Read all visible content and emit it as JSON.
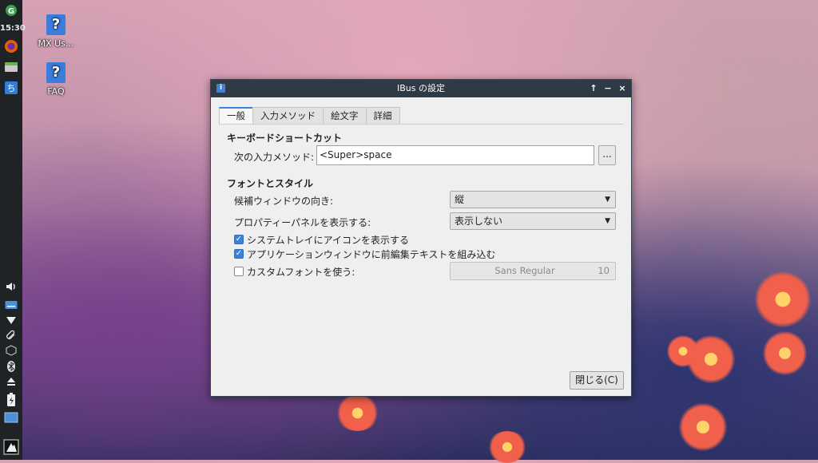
{
  "taskbar": {
    "clock": "15:30",
    "icons": [
      "update-icon",
      "firefox-icon",
      "file-manager-icon",
      "input-method-icon",
      "volume-icon",
      "keyboard-icon",
      "network-icon",
      "clip-icon",
      "package-icon",
      "bluetooth-icon",
      "eject-icon",
      "battery-icon",
      "window-icon",
      "mx-menu-icon"
    ]
  },
  "desktop": {
    "icons": [
      {
        "label": "MX Us..."
      },
      {
        "label": "FAQ"
      }
    ]
  },
  "dialog": {
    "title": "IBus の設定",
    "tabs": [
      "一般",
      "入力メソッド",
      "絵文字",
      "詳細"
    ],
    "keyboard_section": "キーボードショートカット",
    "next_method_label": "次の入力メソッド:",
    "next_method_value": "<Super>space",
    "more_button": "...",
    "font_section": "フォントとスタイル",
    "orientation_label": "候補ウィンドウの向き:",
    "orientation_value": "縦",
    "panel_label": "プロパティーパネルを表示する:",
    "panel_value": "表示しない",
    "tray_label": "システムトレイにアイコンを表示する",
    "tray_checked": true,
    "embed_label": "アプリケーションウィンドウに前編集テキストを組み込む",
    "embed_checked": true,
    "custom_font_label": "カスタムフォントを使う:",
    "custom_font_checked": false,
    "font_name": "Sans Regular",
    "font_size": "10",
    "close_button": "閉じる(C)"
  },
  "colors": {
    "accent": "#3b82d8",
    "titlebar": "#2f3a47",
    "panel": "#1f2326"
  }
}
